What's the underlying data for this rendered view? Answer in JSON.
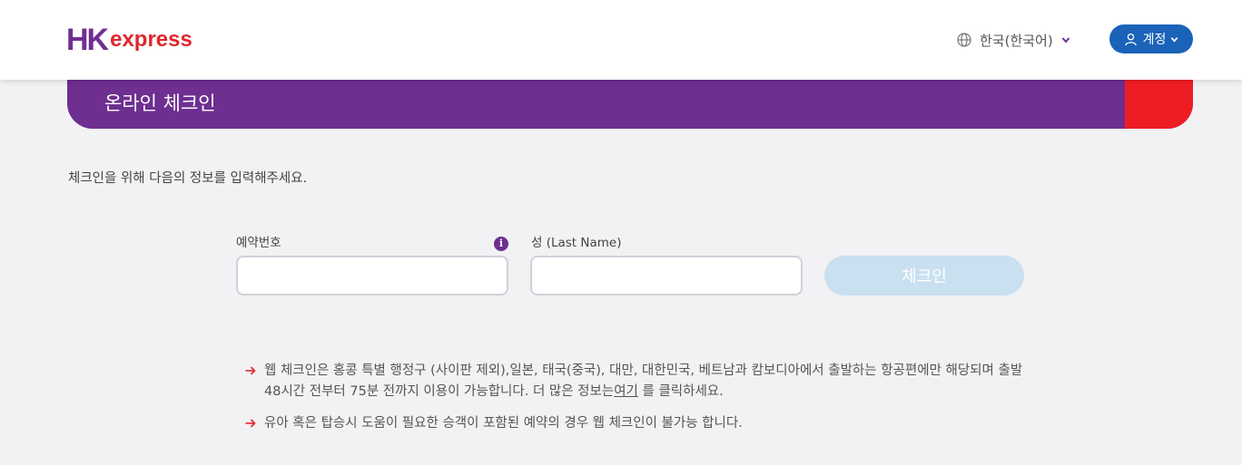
{
  "header": {
    "logo": {
      "hk": "HK",
      "express": "express"
    },
    "language_label": "한국(한국어)",
    "account_label": "계정"
  },
  "banner": {
    "title": "온라인 체크인"
  },
  "form": {
    "instruction": "체크인을 위해 다음의 정보를 입력해주세요.",
    "booking_label": "예약번호",
    "booking_value": "",
    "lastname_label": "성 (Last Name)",
    "lastname_value": "",
    "submit_label": "체크인"
  },
  "notes": [
    {
      "text_before": "웹 체크인은 홍콩 특별 행정구 (사이판 제외),일본, 태국(중국), 대만, 대한민국, 베트남과 캄보디아에서 출발하는 항공편에만 해당되며 출발 48시간 전부터 75분 전까지 이용이 가능합니다. 더 많은 정보는",
      "link": "여기",
      "text_after": " 를 클릭하세요."
    },
    {
      "text": "유아 혹은 탑승시 도움이 필요한 승객이 포함된 예약의 경우 웹 체크인이 불가능 합니다."
    }
  ],
  "colors": {
    "brand_purple": "#6e2f91",
    "brand_red": "#ee1d23",
    "account_blue": "#1a63b8",
    "button_disabled": "#c9e0f1"
  },
  "icons": [
    "globe-icon",
    "chevron-down-icon",
    "user-icon",
    "info-icon",
    "arrow-right-icon"
  ]
}
